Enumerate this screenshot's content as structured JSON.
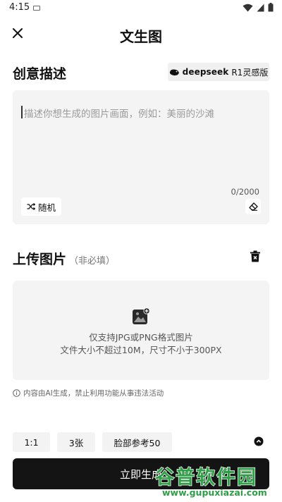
{
  "status_bar": {
    "time": "4:15"
  },
  "header": {
    "title": "文生图"
  },
  "prompt_section": {
    "title": "创意描述",
    "model_brand": "deepseek",
    "model_suffix": "R1灵感版",
    "placeholder": "描述你想生成的图片画面，例如：美丽的沙滩",
    "char_count": "0/2000",
    "random_label": "随机"
  },
  "upload_section": {
    "title": "上传图片",
    "note": "（非必填）",
    "hint_line1": "仅支持JPG或PNG格式图片",
    "hint_line2": "文件大小不超过10M，尺寸不小于300PX"
  },
  "disclaimer": "内容由AI生成，禁止利用功能从事违法活动",
  "options": {
    "ratio": "1:1",
    "count": "3张",
    "face_ref": "脸部参考50"
  },
  "generate_label": "立即生成",
  "watermark": {
    "main": "谷普软件园",
    "url": "www.gupuxiazai.com"
  },
  "icons": {
    "close": "close-icon",
    "model_logo": "deepseek-whale-icon",
    "random": "shuffle-icon",
    "eraser": "eraser-icon",
    "trash": "trash-icon",
    "upload": "add-image-icon",
    "info": "info-icon",
    "collapse": "chevron-up-circle-icon"
  }
}
